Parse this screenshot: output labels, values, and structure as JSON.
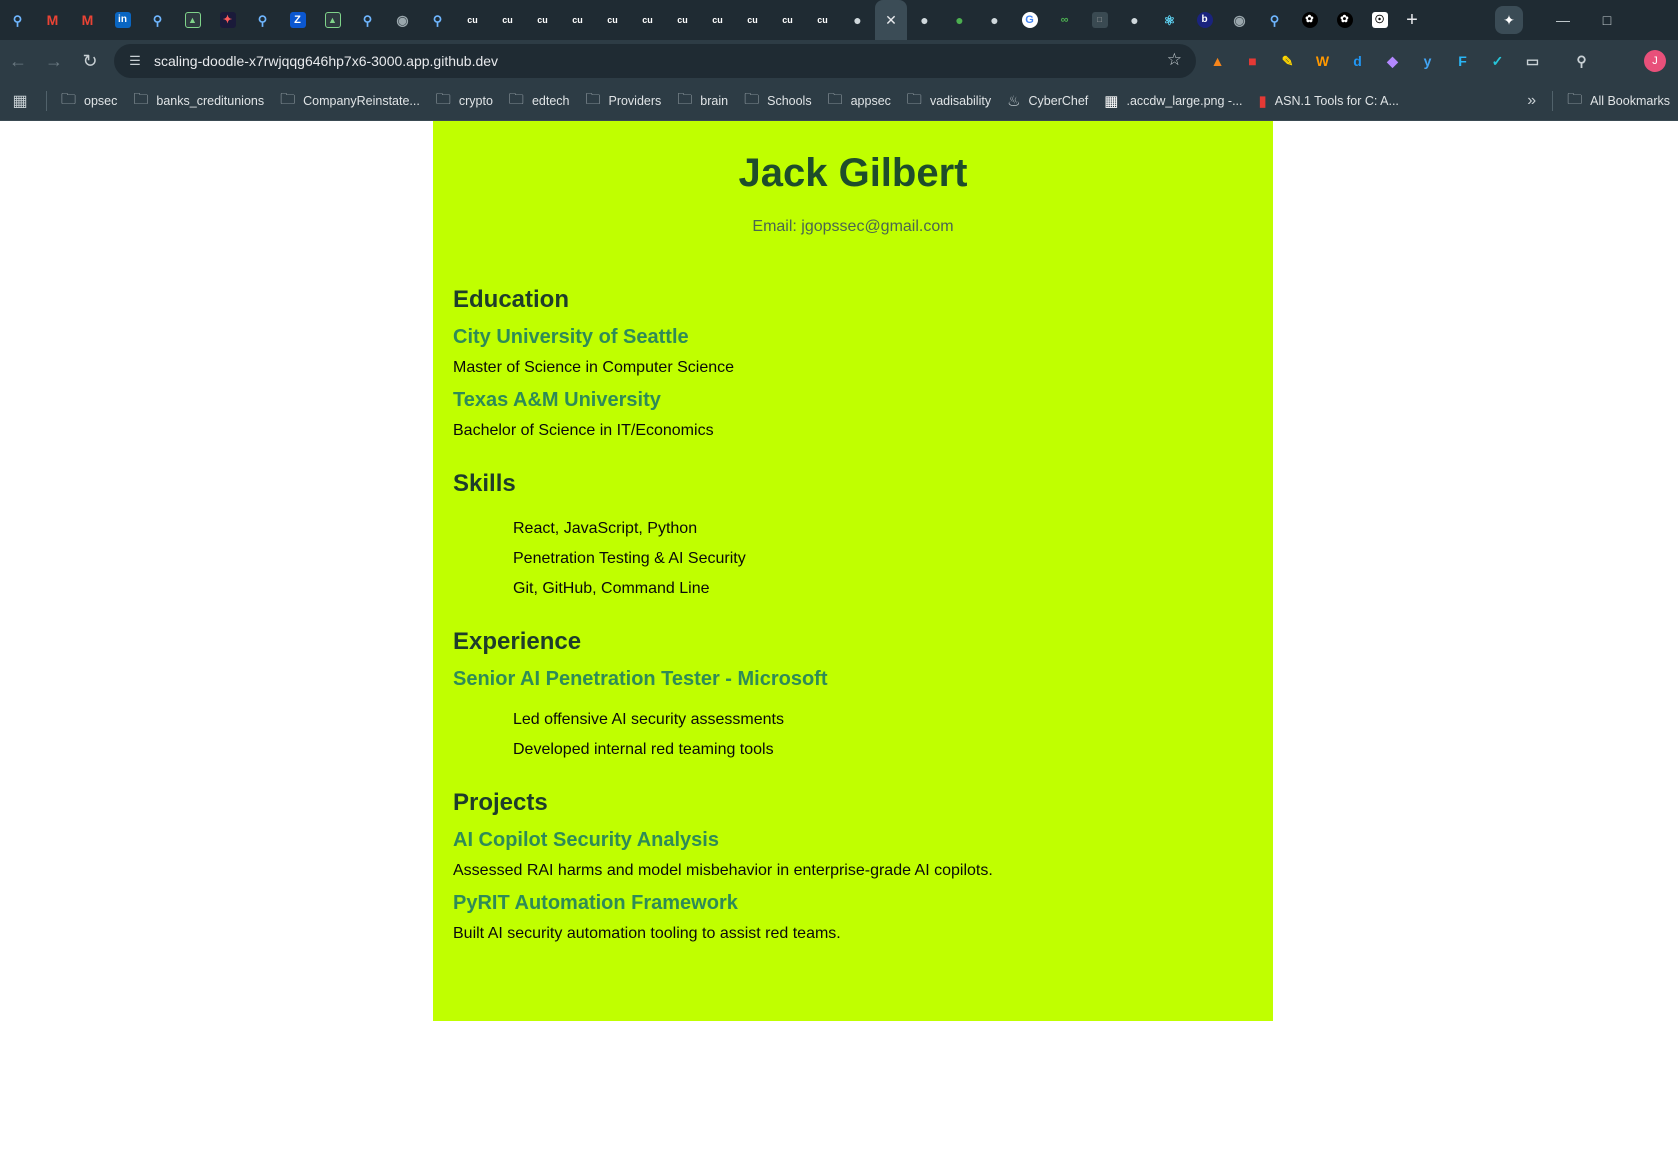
{
  "browser": {
    "tabs": [
      {
        "icon": "search-icon"
      },
      {
        "icon": "gmail-icon"
      },
      {
        "icon": "gmail-icon"
      },
      {
        "icon": "linkedin-icon"
      },
      {
        "icon": "search-icon"
      },
      {
        "icon": "chart-icon"
      },
      {
        "icon": "app-icon"
      },
      {
        "icon": "search-icon"
      },
      {
        "icon": "app-icon"
      },
      {
        "icon": "chart-icon"
      },
      {
        "icon": "search-icon"
      },
      {
        "icon": "globe-icon"
      },
      {
        "icon": "search-icon"
      },
      {
        "icon": "cu-icon"
      },
      {
        "icon": "cu-icon"
      },
      {
        "icon": "cu-icon"
      },
      {
        "icon": "cu-icon"
      },
      {
        "icon": "cu-icon"
      },
      {
        "icon": "cu-icon"
      },
      {
        "icon": "cu-icon"
      },
      {
        "icon": "cu-icon"
      },
      {
        "icon": "cu-icon"
      },
      {
        "icon": "cu-icon"
      },
      {
        "icon": "cu-icon"
      }
    ],
    "url": "scaling-doodle-x7rwjqqg646hp7x6-3000.app.github.dev",
    "avatar_letter": "J",
    "bookmarks": [
      {
        "label": "opsec",
        "icon": "folder-icon"
      },
      {
        "label": "banks_creditunions",
        "icon": "folder-icon"
      },
      {
        "label": "CompanyReinstate...",
        "icon": "folder-icon"
      },
      {
        "label": "crypto",
        "icon": "folder-icon"
      },
      {
        "label": "edtech",
        "icon": "folder-icon"
      },
      {
        "label": "Providers",
        "icon": "folder-icon"
      },
      {
        "label": "brain",
        "icon": "folder-icon"
      },
      {
        "label": "Schools",
        "icon": "folder-icon"
      },
      {
        "label": "appsec",
        "icon": "folder-icon"
      },
      {
        "label": "vadisability",
        "icon": "folder-icon"
      },
      {
        "label": "CyberChef",
        "icon": "chef-icon"
      },
      {
        "label": ".accdw_large.png -...",
        "icon": "windows-icon"
      },
      {
        "label": "ASN.1 Tools for C: A...",
        "icon": "bookmark-icon"
      }
    ],
    "all_bookmarks_label": "All Bookmarks"
  },
  "resume": {
    "name": "Jack Gilbert",
    "email": "Email: jgopssec@gmail.com",
    "education": {
      "title": "Education",
      "entries": [
        {
          "school": "City University of Seattle",
          "degree": "Master of Science in Computer Science"
        },
        {
          "school": "Texas A&M University",
          "degree": "Bachelor of Science in IT/Economics"
        }
      ]
    },
    "skills": {
      "title": "Skills",
      "items": [
        "React, JavaScript, Python",
        "Penetration Testing & AI Security",
        "Git, GitHub, Command Line"
      ]
    },
    "experience": {
      "title": "Experience",
      "role": "Senior AI Penetration Tester - Microsoft",
      "items": [
        "Led offensive AI security assessments",
        "Developed internal red teaming tools"
      ]
    },
    "projects": {
      "title": "Projects",
      "entries": [
        {
          "name": "AI Copilot Security Analysis",
          "desc": "Assessed RAI harms and model misbehavior in enterprise-grade AI copilots."
        },
        {
          "name": "PyRIT Automation Framework",
          "desc": "Built AI security automation tooling to assist red teams."
        }
      ]
    }
  }
}
